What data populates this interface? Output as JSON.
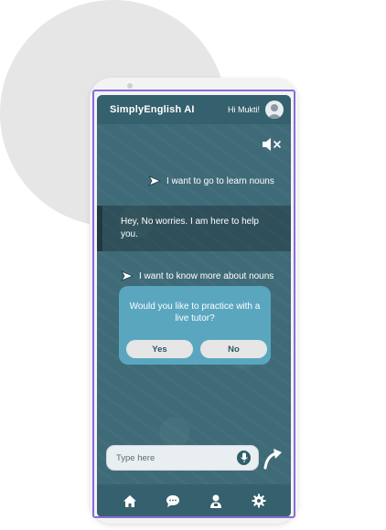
{
  "header": {
    "app_title": "SimplyEnglish AI",
    "greeting": "Hi Mukti!"
  },
  "icons": {
    "avatar": "user-avatar-icon",
    "mute": "speaker-muted-icon",
    "message_sent": "send-arrow-icon",
    "mic": "microphone-icon",
    "send": "curved-arrow-icon",
    "nav": [
      "home-icon",
      "chat-icon",
      "tutor-icon",
      "settings-icon"
    ]
  },
  "chat": {
    "messages": [
      {
        "role": "user",
        "text": "I want to go to learn nouns"
      },
      {
        "role": "bot",
        "text": "Hey, No worries. I am here to help you."
      },
      {
        "role": "user",
        "text": "I want to know more about nouns"
      }
    ],
    "tutor_prompt": {
      "question": "Would you like to practice with a live tutor?",
      "yes_label": "Yes",
      "no_label": "No"
    }
  },
  "composer": {
    "placeholder": "Type here",
    "value": ""
  },
  "colors": {
    "screen_background": "#3f6b78",
    "header_background": "#35606d",
    "tutor_card": "#5aa6bf",
    "button_background": "#e6e6e6",
    "selection_frame": "#8a6bd8"
  }
}
